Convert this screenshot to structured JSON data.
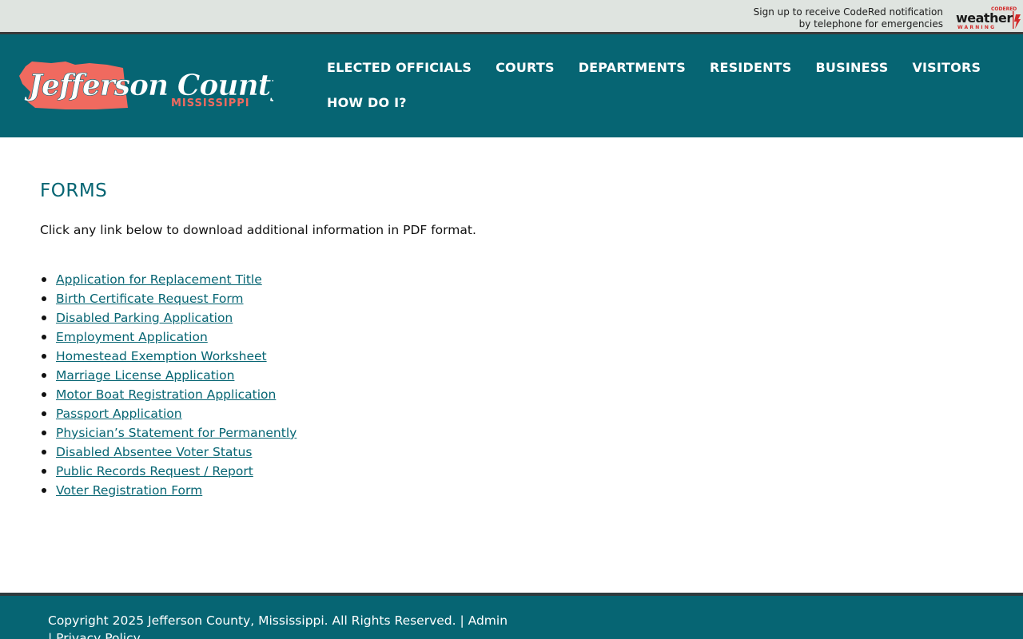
{
  "topbar": {
    "notice_line1": "Sign up to receive CodeRed notification",
    "notice_line2": "by telephone for emergencies",
    "badge_top": "CODERED",
    "badge_main": "weather",
    "badge_bottom": "WARNING"
  },
  "header": {
    "logo_main": "Jefferson County",
    "logo_sub": "MISSISSIPPI",
    "logo_shape_color": "#f06a5f",
    "background_color": "#066573"
  },
  "nav": {
    "items": [
      {
        "label": "ELECTED OFFICIALS"
      },
      {
        "label": "COURTS"
      },
      {
        "label": "DEPARTMENTS"
      },
      {
        "label": "RESIDENTS"
      },
      {
        "label": "BUSINESS"
      },
      {
        "label": "VISITORS"
      },
      {
        "label": "HOW DO I?"
      }
    ]
  },
  "main": {
    "title": "FORMS",
    "intro": "Click any link below to download additional information in PDF format.",
    "forms": [
      "Application for Replacement Title",
      "Birth Certificate Request Form",
      "Disabled Parking Application",
      "Employment Application",
      "Homestead Exemption Worksheet",
      "Marriage License Application",
      "Motor Boat Registration Application",
      "Passport Application",
      "Physician’s Statement for Permanently",
      "Disabled Absentee Voter Status",
      "Public Records Request / Report",
      "Voter Registration Form"
    ]
  },
  "footer": {
    "copyright": "Copyright 2025 Jefferson County, Mississippi. All Rights Reserved.",
    "separator": " | ",
    "admin_label": "Admin",
    "privacy_label": "Privacy Policy"
  }
}
